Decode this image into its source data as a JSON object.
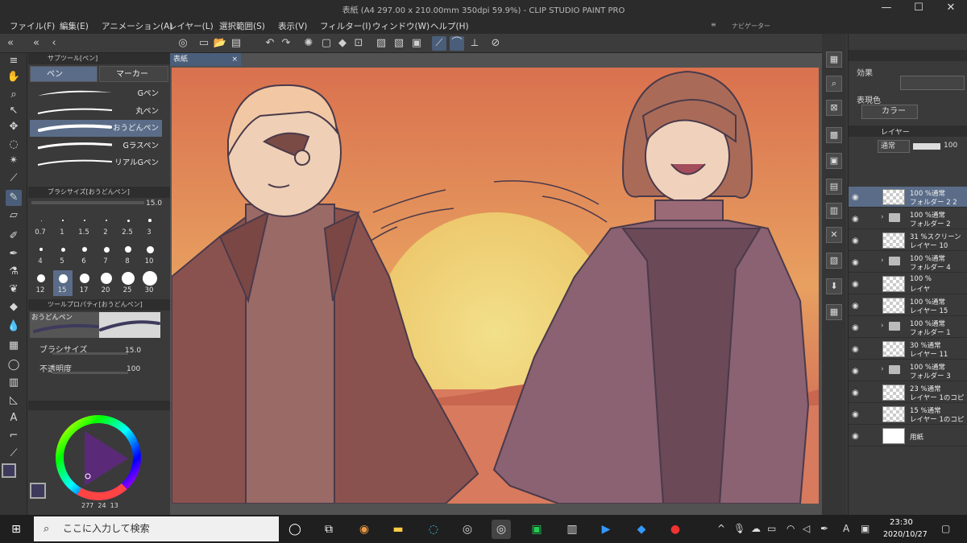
{
  "window": {
    "title": "表紙 (A4 297.00 x 210.00mm 350dpi 59.9%) - CLIP STUDIO PAINT PRO",
    "minimize": "—",
    "maximize": "☐",
    "close": "✕"
  },
  "menu": [
    "ファイル(F)",
    "編集(E)",
    "アニメーション(A)",
    "レイヤー(L)",
    "選択範囲(S)",
    "表示(V)",
    "フィルター(I)",
    "ウィンドウ(W)",
    "ヘルプ(H)"
  ],
  "navigator": {
    "label": "ナビゲーター"
  },
  "subtool": {
    "header": "サブツール[ペン]",
    "tabs": [
      "ペン",
      "マーカー"
    ],
    "brushes": [
      "Gペン",
      "丸ペン",
      "おうどんペン",
      "Gラスペン",
      "リアルGペン"
    ],
    "selected_brush": "おうどんペン"
  },
  "brushsize": {
    "header": "ブラシサイズ[おうどんペン]",
    "value": "15.0",
    "presets": [
      "0.7",
      "1",
      "1.5",
      "2",
      "2.5",
      "3",
      "4",
      "5",
      "6",
      "7",
      "8",
      "10",
      "12",
      "15",
      "17",
      "20",
      "25",
      "30"
    ],
    "selected": "15"
  },
  "toolprop": {
    "header": "ツールプロパティ[おうどんペン]",
    "brush_name": "おうどんペン",
    "size_label": "ブラシサイズ",
    "size_value": "15.0",
    "opacity_label": "不透明度",
    "opacity_value": "100"
  },
  "color": {
    "main": "#3d3a5c",
    "sub": "#ffffff",
    "readout": [
      "277",
      "24",
      "13"
    ]
  },
  "document": {
    "tab": "表紙",
    "close": "×"
  },
  "props": {
    "effect_label": "効果",
    "expression_label": "表現色",
    "expression_value": "カラー"
  },
  "layers": {
    "tab": "レイヤー",
    "blend": "通常",
    "opacity": "100",
    "items": [
      {
        "t1": "100 %通常",
        "t2": "フォルダー 2 2",
        "type": "img",
        "sel": true
      },
      {
        "t1": "100 %通常",
        "t2": "フォルダー 2",
        "type": "folder"
      },
      {
        "t1": "31 %スクリーン",
        "t2": "レイヤー 10",
        "type": "img"
      },
      {
        "t1": "100 %通常",
        "t2": "フォルダー 4",
        "type": "folder"
      },
      {
        "t1": "100 %",
        "t2": "レイヤ",
        "type": "img"
      },
      {
        "t1": "100 %通常",
        "t2": "レイヤー 15",
        "type": "img"
      },
      {
        "t1": "100 %通常",
        "t2": "フォルダー 1",
        "type": "folder"
      },
      {
        "t1": "30 %通常",
        "t2": "レイヤー 11",
        "type": "img"
      },
      {
        "t1": "100 %通常",
        "t2": "フォルダー 3",
        "type": "folder"
      },
      {
        "t1": "23 %通常",
        "t2": "レイヤー 1のコピ",
        "type": "img"
      },
      {
        "t1": "15 %通常",
        "t2": "レイヤー 1のコピ",
        "type": "img"
      },
      {
        "t1": "用紙",
        "t2": "",
        "type": "paper"
      }
    ]
  },
  "taskbar": {
    "search_placeholder": "ここに入力して検索",
    "time": "23:30",
    "date": "2020/10/27",
    "ime": "A"
  }
}
